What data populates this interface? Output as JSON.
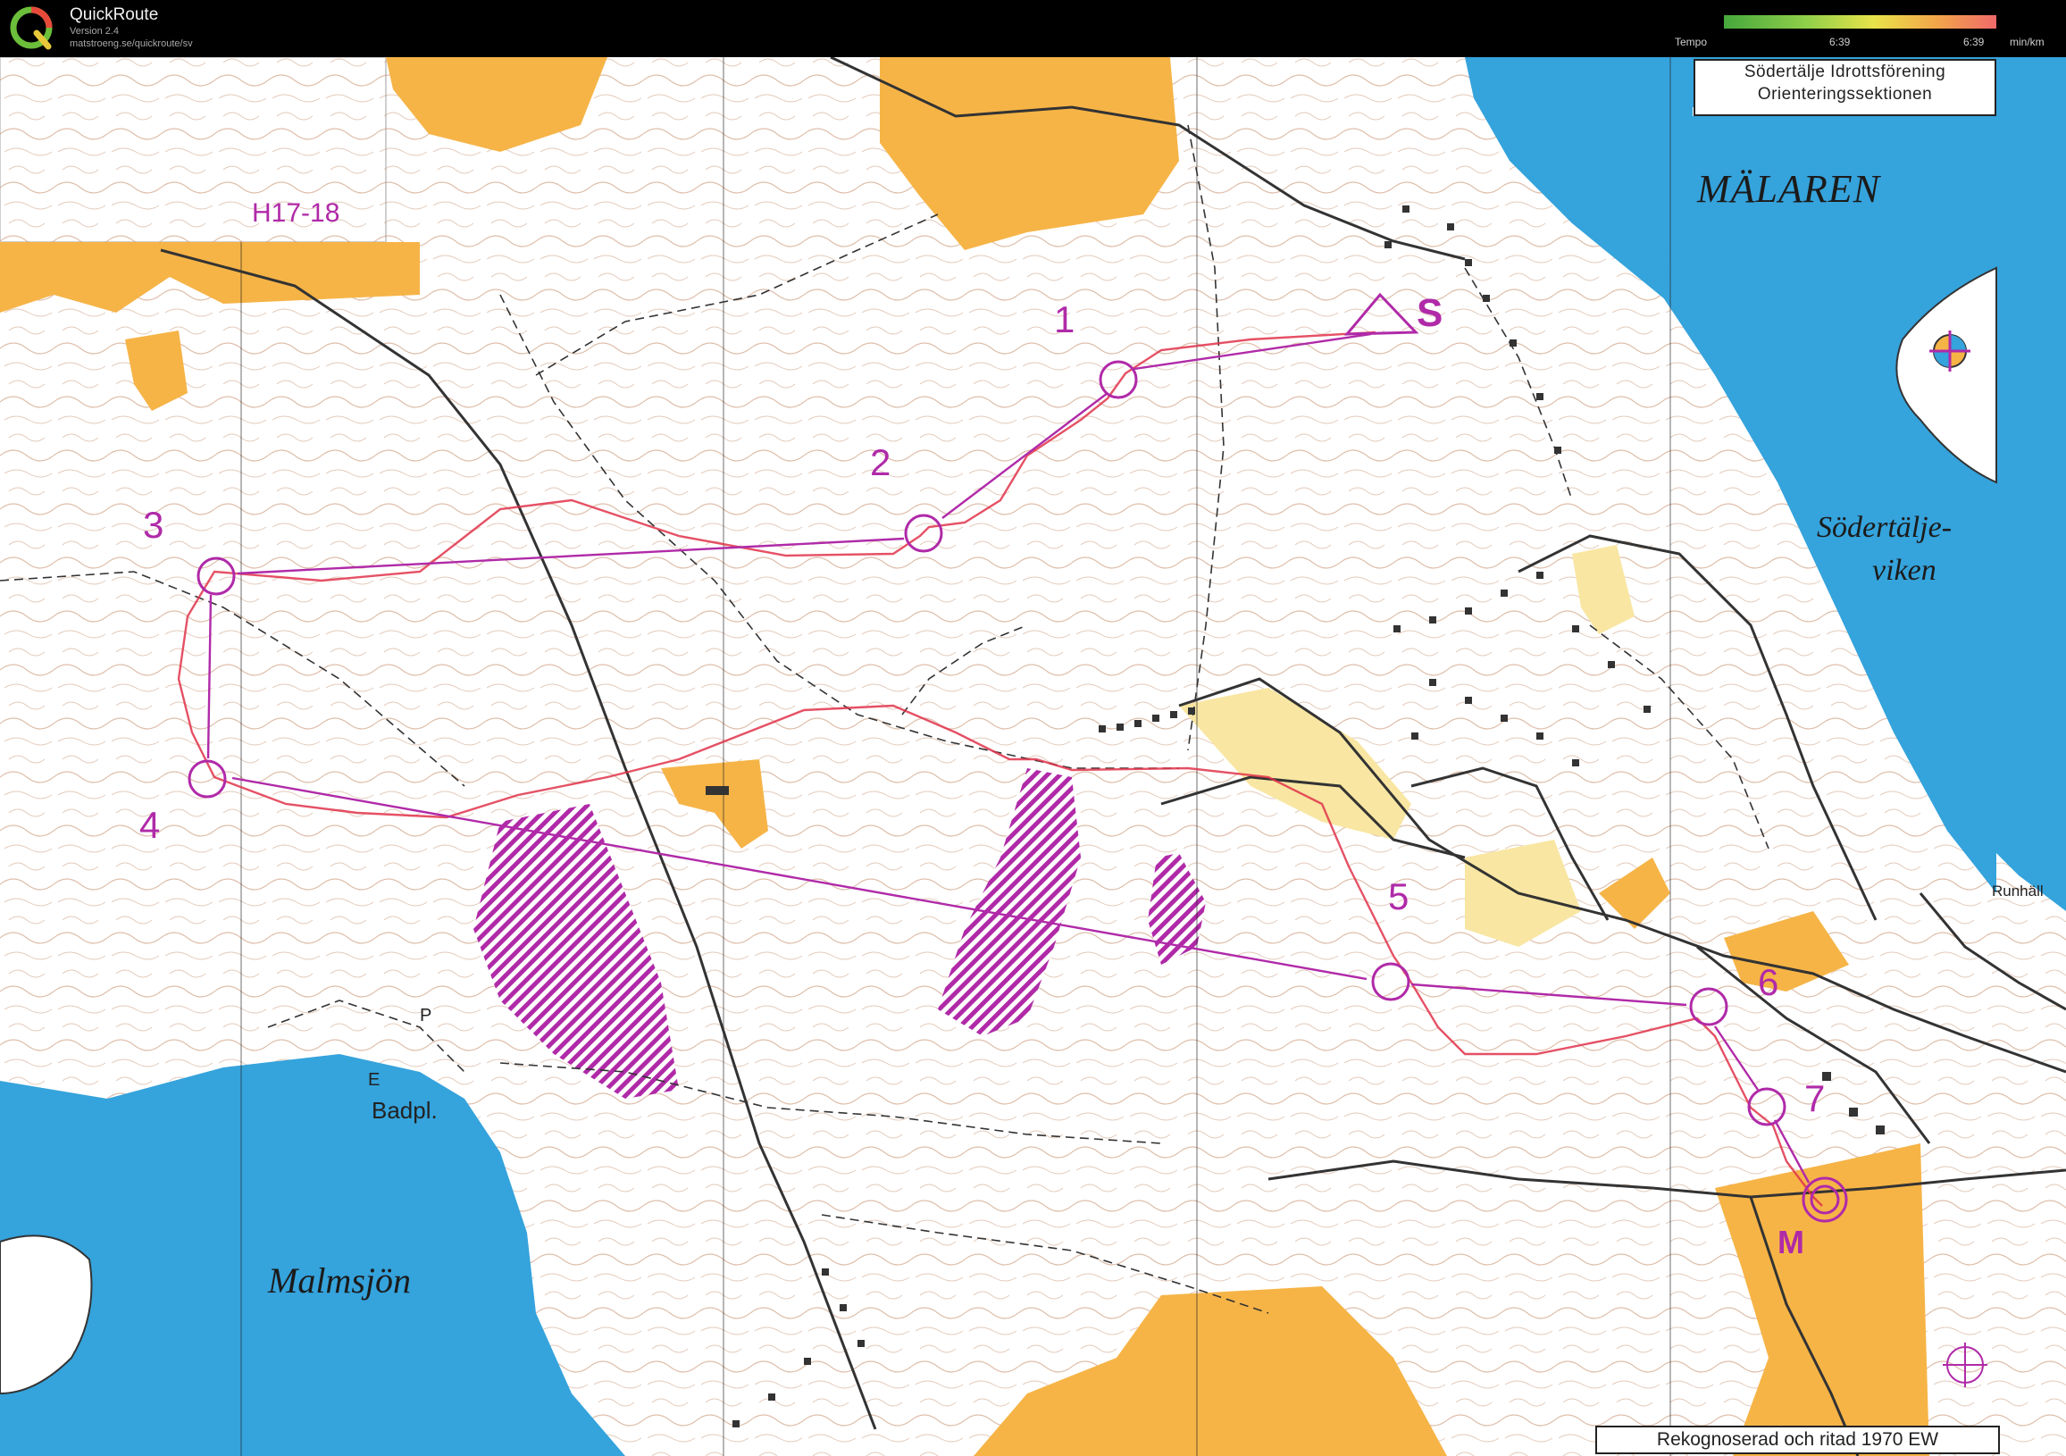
{
  "app": {
    "title": "QuickRoute",
    "version": "Version 2.4",
    "url": "matstroeng.se/quickroute/sv"
  },
  "tempo": {
    "label": "Tempo",
    "value_mid": "6:39",
    "value_right": "6:39",
    "unit": "min/km"
  },
  "map": {
    "club_line1": "Södertälje Idrottsförening",
    "club_line2": "Orienteringssektionen",
    "credit": "Rekognoserad och ritad 1970  EW",
    "course_name": "H17-18",
    "start_label": "S",
    "finish_label": "M",
    "place_names": {
      "malaren": "MÄLAREN",
      "sodertalje_viken_1": "Södertälje-",
      "sodertalje_viken_2": "viken",
      "malmsjon": "Malmsjön",
      "badpl": "Badpl.",
      "runhall": "Runhäll",
      "e_letter": "E",
      "p_letter": "P"
    },
    "controls": [
      "1",
      "2",
      "3",
      "4",
      "5",
      "6",
      "7"
    ],
    "colors": {
      "water": "#35a3dc",
      "open_land": "#f6b447",
      "rough_open": "#f8e6a2",
      "course": "#b02aa8",
      "route": "#e0334a",
      "contour": "#a0603a",
      "road": "#333333"
    }
  }
}
